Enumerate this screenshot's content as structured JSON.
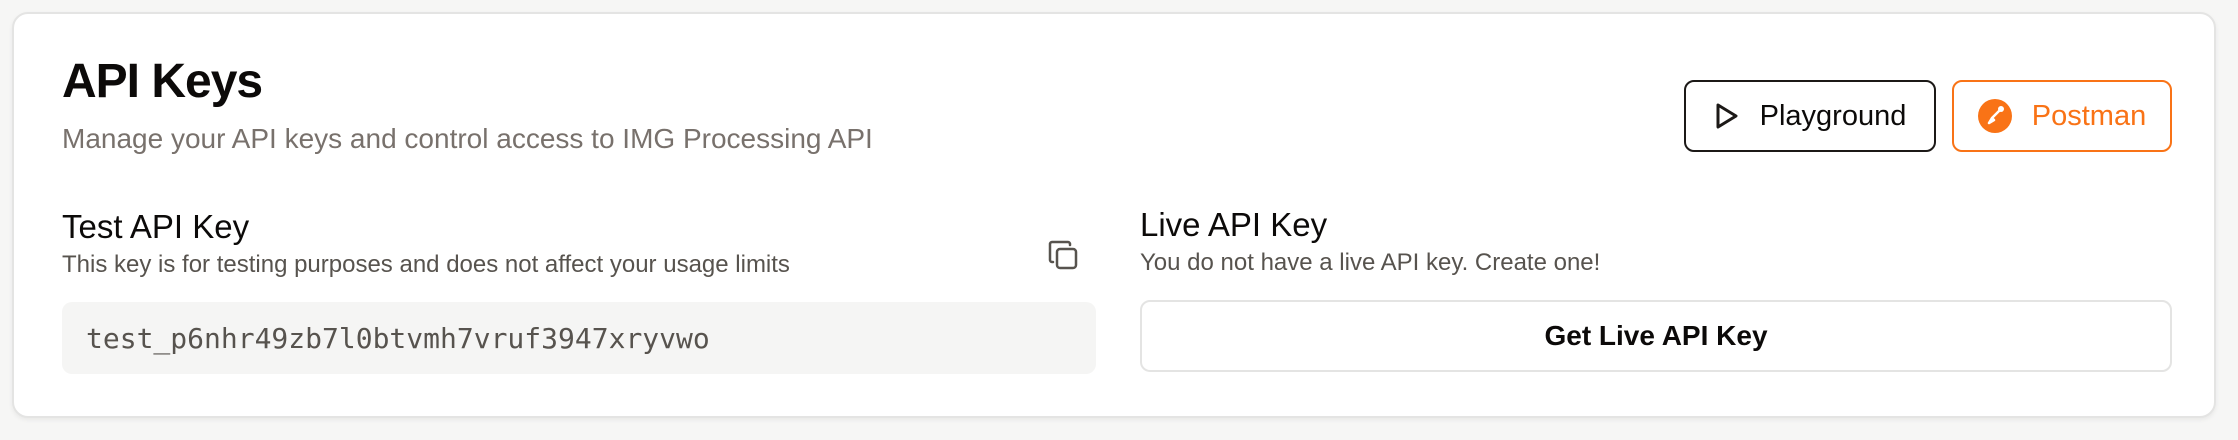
{
  "header": {
    "title": "API Keys",
    "subtitle": "Manage your API keys and control access to IMG Processing API"
  },
  "actions": {
    "playground_label": "Playground",
    "postman_label": "Postman",
    "playground_icon": "play-icon",
    "postman_icon": "postman-logo-icon"
  },
  "test_key": {
    "title": "Test API Key",
    "description": "This key is for testing purposes and does not affect your usage limits",
    "value": "test_p6nhr49zb7l0btvmh7vruf3947xryvwo",
    "copy_icon": "copy-icon"
  },
  "live_key": {
    "title": "Live API Key",
    "description": "You do not have a live API key. Create one!",
    "button_label": "Get Live API Key"
  },
  "colors": {
    "accent": "#f97316",
    "text_primary": "#0c0a09",
    "text_muted": "#78716c",
    "key_background": "#f5f5f4"
  }
}
